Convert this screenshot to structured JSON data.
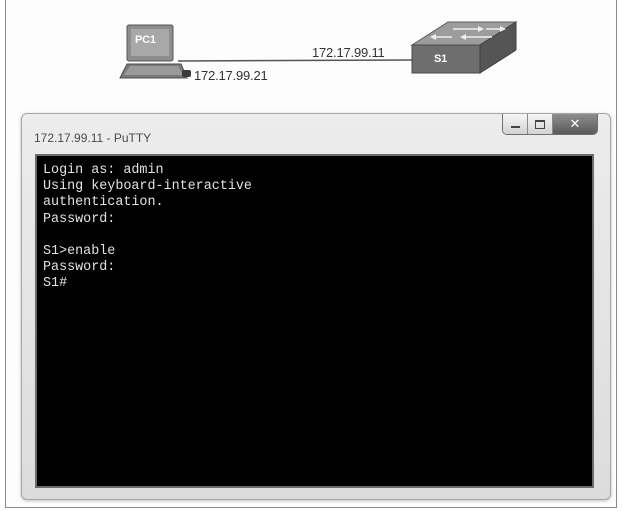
{
  "topology": {
    "pc": {
      "label": "PC1",
      "ip": "172.17.99.21",
      "icon": "pc-icon"
    },
    "switch": {
      "label": "S1",
      "ip": "172.17.99.11",
      "icon": "switch-icon"
    }
  },
  "window": {
    "title": "172.17.99.11 - PuTTY",
    "buttons": {
      "minimize": "minimize-icon",
      "maximize": "maximize-icon",
      "close": "close-icon"
    }
  },
  "terminal": {
    "lines": [
      "Login as: admin",
      "Using keyboard-interactive",
      "authentication.",
      "Password:",
      "",
      "S1>enable",
      "Password:",
      "S1#"
    ]
  },
  "colors": {
    "terminal_bg": "#000000",
    "terminal_fg": "#e2e2e2",
    "window_chrome": "#e4e4e4",
    "close_button": "#6a6a6a"
  }
}
